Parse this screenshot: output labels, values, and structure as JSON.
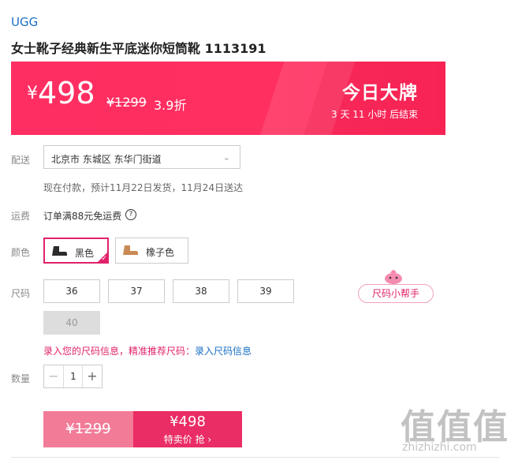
{
  "brand": "UGG",
  "title": "女士靴子经典新生平底迷你短筒靴 1113191",
  "banner": {
    "currency": "¥",
    "price": "498",
    "original_price": "¥1299",
    "discount": "3.9折",
    "promo_title": "今日大牌",
    "countdown": "3 天 11 小时 后结束"
  },
  "delivery": {
    "label": "配送",
    "address": "北京市 东城区 东华门街道",
    "note": "现在付款，预计11月22日发货，11月24日送达"
  },
  "freight": {
    "label": "运费",
    "text": "订单满88元免运费",
    "help_glyph": "?"
  },
  "color": {
    "label": "颜色",
    "options": [
      {
        "name": "黑色",
        "selected": true,
        "swatch": "#2b2b2b"
      },
      {
        "name": "橡子色",
        "selected": false,
        "swatch": "#c98a55"
      }
    ]
  },
  "size": {
    "label": "尺码",
    "options": [
      {
        "value": "36",
        "available": true
      },
      {
        "value": "37",
        "available": true
      },
      {
        "value": "38",
        "available": true
      },
      {
        "value": "39",
        "available": true
      },
      {
        "value": "40",
        "available": false
      }
    ],
    "helper": "尺码小帮手",
    "info_text": "录入您的尺码信息，精准推荐尺码：",
    "info_link": "录入尺码信息"
  },
  "quantity": {
    "label": "数量",
    "value": "1",
    "minus": "−",
    "plus": "+"
  },
  "buy": {
    "original_price": "¥1299",
    "price": "¥498",
    "sub": "特卖价 抢 ›"
  },
  "watermark": {
    "big": "值值值",
    "small": "zhizhizhi.com"
  },
  "colors": {
    "accent": "#ff2e62",
    "pink": "#e0226a",
    "link": "#1a6fc6"
  }
}
